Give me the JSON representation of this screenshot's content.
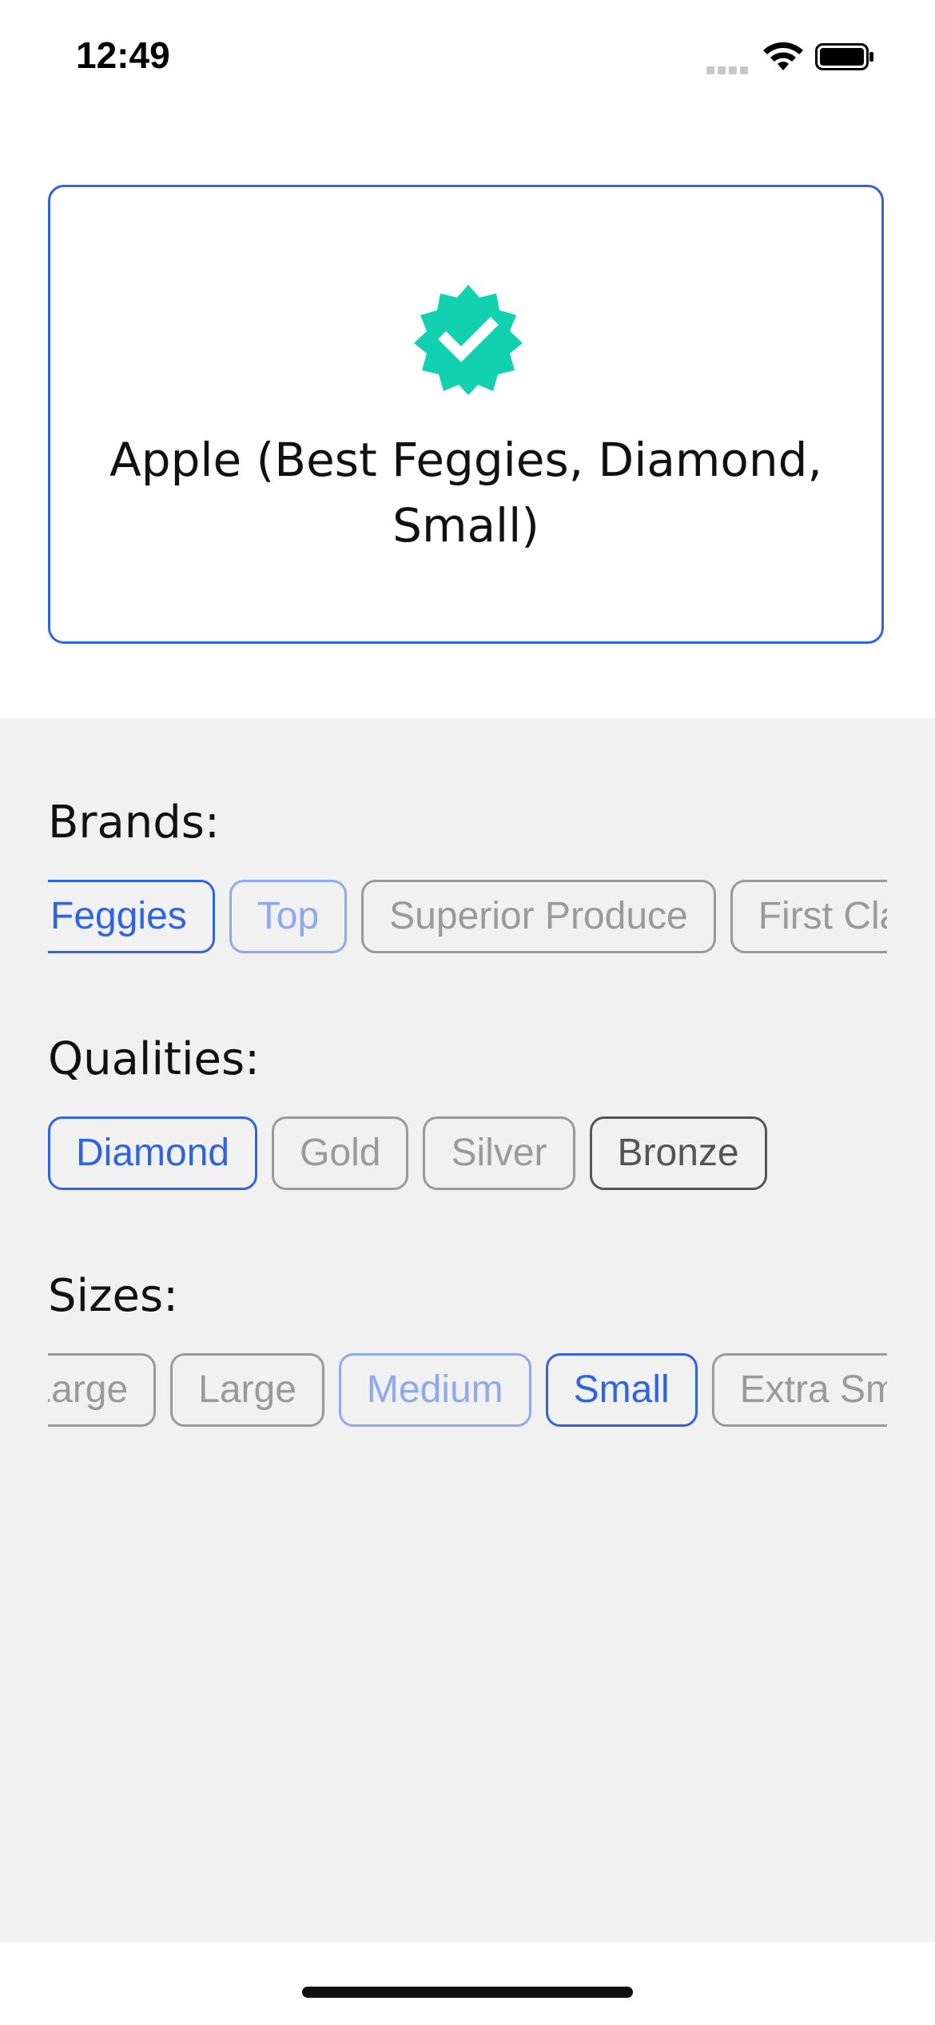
{
  "status_bar": {
    "time": "12:49"
  },
  "product": {
    "title": "Apple (Best Feggies, Diamond, Small)",
    "badge_color": "#12d1b1"
  },
  "accent_color": "#2f63e0",
  "brands": {
    "label": "Brands:",
    "chips": [
      {
        "label": "Feggies",
        "state": "selected"
      },
      {
        "label": "Top",
        "state": "soft"
      },
      {
        "label": "Superior Produce",
        "state": "normal"
      },
      {
        "label": "First Class",
        "state": "normal"
      }
    ]
  },
  "qualities": {
    "label": "Qualities:",
    "chips": [
      {
        "label": "Diamond",
        "state": "selected"
      },
      {
        "label": "Gold",
        "state": "normal"
      },
      {
        "label": "Silver",
        "state": "normal"
      },
      {
        "label": "Bronze",
        "state": "dark"
      }
    ]
  },
  "sizes": {
    "label": "Sizes:",
    "chips": [
      {
        "label": "Extra Large",
        "state": "normal"
      },
      {
        "label": "Large",
        "state": "normal"
      },
      {
        "label": "Medium",
        "state": "soft"
      },
      {
        "label": "Small",
        "state": "selected"
      },
      {
        "label": "Extra Small",
        "state": "normal"
      }
    ]
  }
}
